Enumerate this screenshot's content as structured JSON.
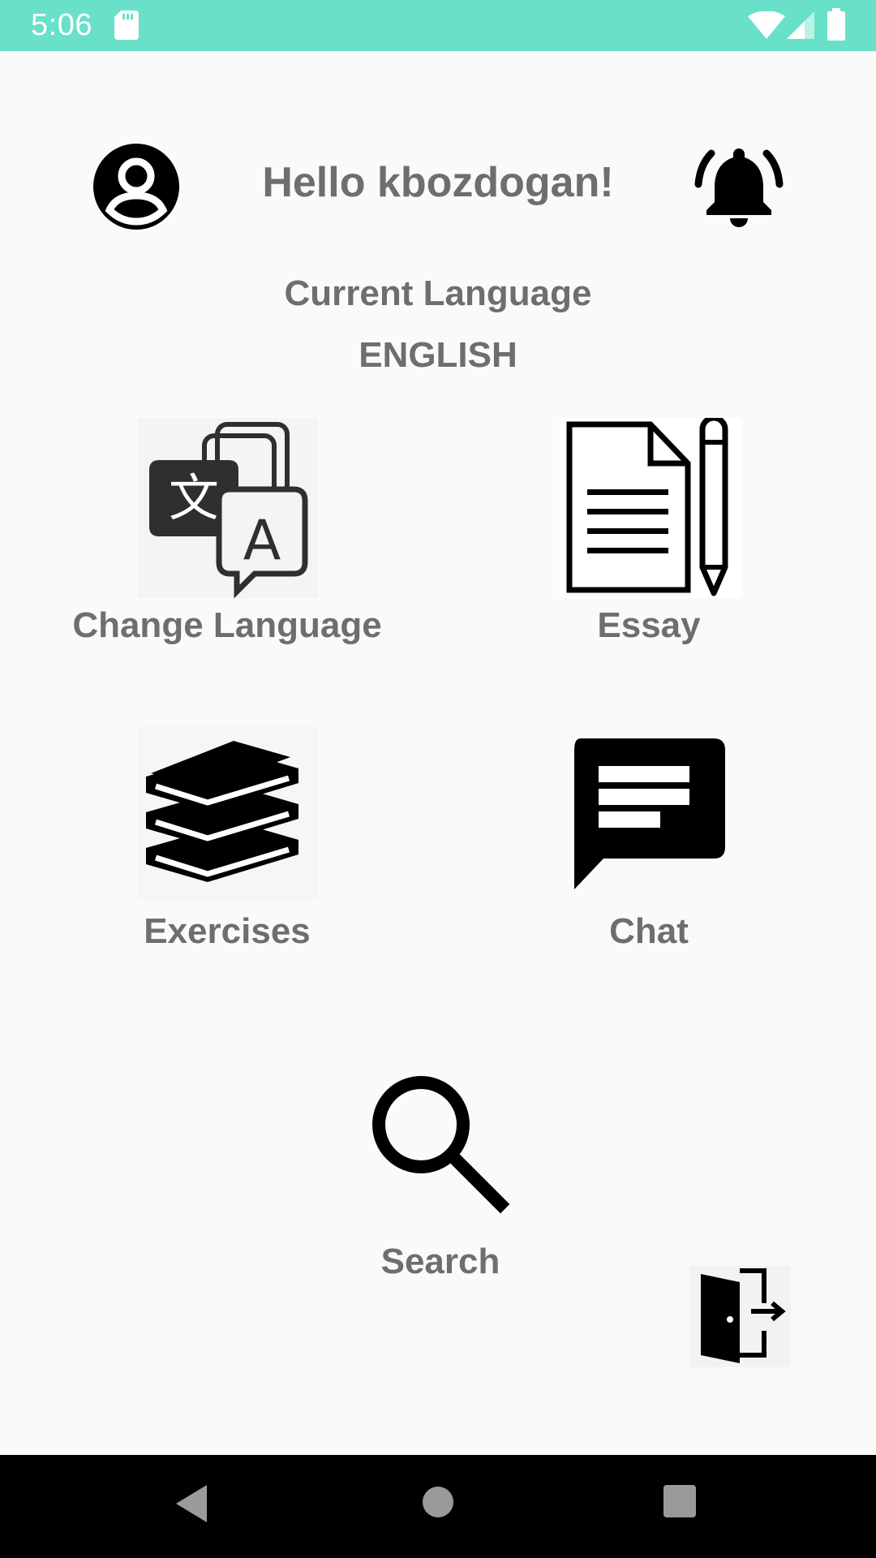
{
  "status_bar": {
    "time": "5:06",
    "background": "#69e0c8",
    "icons": [
      "sd-card-icon",
      "wifi-icon",
      "signal-icon",
      "battery-icon"
    ]
  },
  "header": {
    "greeting": "Hello kbozdogan!",
    "profile_icon": "account-circle-icon",
    "notification_icon": "bell-icon"
  },
  "language": {
    "label": "Current Language",
    "value": "ENGLISH"
  },
  "tiles": [
    {
      "label": "Change Language",
      "icon": "translate-icon"
    },
    {
      "label": "Essay",
      "icon": "document-pencil-icon"
    },
    {
      "label": "Exercises",
      "icon": "books-icon"
    },
    {
      "label": "Chat",
      "icon": "chat-bubble-icon"
    },
    {
      "label": "Search",
      "icon": "search-icon"
    }
  ],
  "logout": {
    "icon": "logout-door-icon"
  },
  "nav_bar": {
    "icons": [
      "back-icon",
      "home-icon",
      "recents-icon"
    ]
  },
  "colors": {
    "text_gray": "#6e6e6e",
    "background": "#fafafa",
    "accent": "#69e0c8"
  }
}
